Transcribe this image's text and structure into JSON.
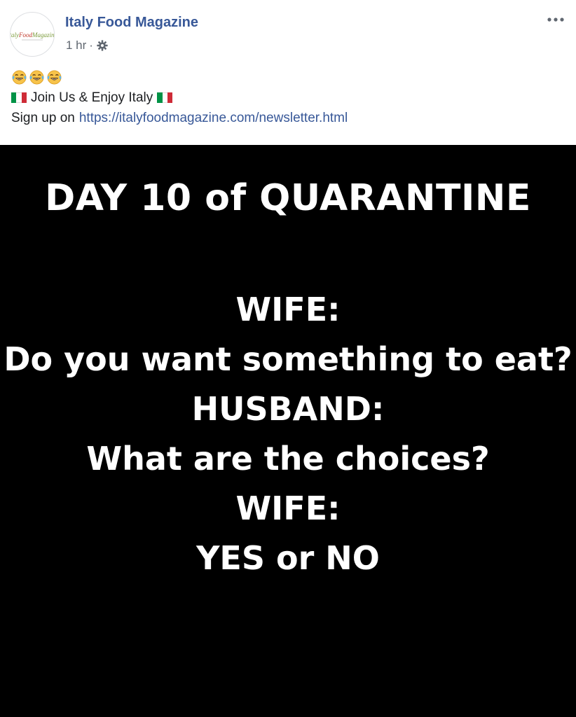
{
  "post": {
    "page_name": "Italy Food Magazine",
    "time": "1 hr",
    "separator": "·",
    "avatar_logo_text": "ItalyFoodMagazine",
    "icons": {
      "avatar": "italy-food-magazine-logo",
      "privacy": "gear-icon",
      "options": "more-options-icon",
      "emoji": "face-with-tears-of-joy-icon",
      "flag": "italy-flag-icon"
    },
    "emoji_count": 3,
    "text_line_1": "Join Us & Enjoy Italy",
    "text_line_2_prefix": "Sign up on",
    "link": "https://italyfoodmagazine.com/newsletter.html"
  },
  "image": {
    "title": "DAY 10 of QUARANTINE",
    "lines": [
      "WIFE:",
      "Do you want something to eat?",
      "HUSBAND:",
      "What are the choices?",
      "WIFE:",
      "YES or NO"
    ]
  },
  "colors": {
    "page_name": "#385898",
    "meta_text": "#606770",
    "body_text": "#1c1e21",
    "link": "#385898",
    "image_bg": "#000000",
    "image_text": "#ffffff",
    "flag_green": "#009246",
    "flag_white": "#ffffff",
    "flag_red": "#ce2b37"
  }
}
